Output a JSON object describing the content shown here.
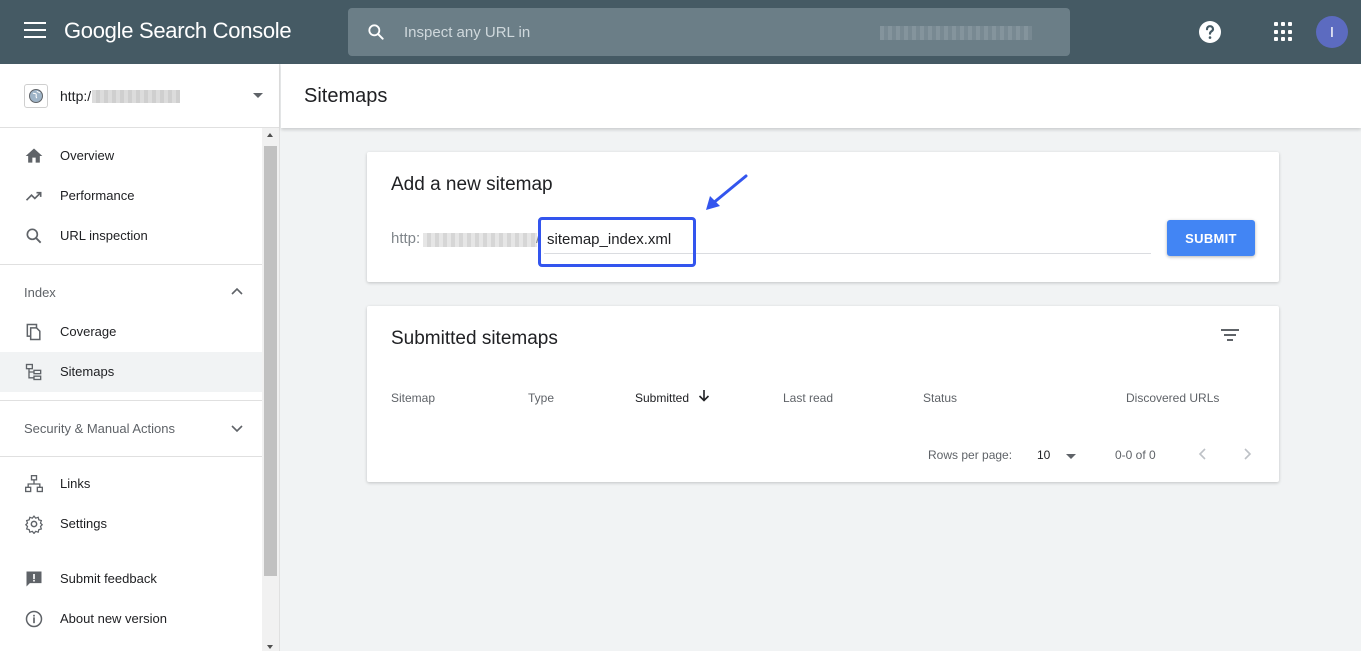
{
  "app": {
    "title": "Google Search Console"
  },
  "search": {
    "placeholder": "Inspect any URL in"
  },
  "user": {
    "avatar_initial": "I"
  },
  "property": {
    "url": "http:/"
  },
  "sidebar": {
    "items": [
      {
        "label": "Overview",
        "icon": "home-icon"
      },
      {
        "label": "Performance",
        "icon": "trending-up-icon"
      },
      {
        "label": "URL inspection",
        "icon": "search-icon"
      }
    ],
    "index_section": {
      "label": "Index",
      "items": [
        {
          "label": "Coverage",
          "icon": "copy-icon"
        },
        {
          "label": "Sitemaps",
          "icon": "sitemap-icon",
          "active": true
        }
      ]
    },
    "security_section": {
      "label": "Security & Manual Actions"
    },
    "bottom_items": [
      {
        "label": "Links",
        "icon": "links-icon"
      },
      {
        "label": "Settings",
        "icon": "gear-icon"
      }
    ],
    "footer_items": [
      {
        "label": "Submit feedback",
        "icon": "feedback-icon"
      },
      {
        "label": "About new version",
        "icon": "info-icon"
      }
    ]
  },
  "page": {
    "title": "Sitemaps"
  },
  "add_sitemap": {
    "title": "Add a new sitemap",
    "prefix": "http:",
    "slash": "/",
    "value": "sitemap_index.xml",
    "submit_label": "SUBMIT"
  },
  "submitted": {
    "title": "Submitted sitemaps",
    "columns": [
      "Sitemap",
      "Type",
      "Submitted",
      "Last read",
      "Status",
      "Discovered URLs"
    ],
    "sorted_column": "Submitted",
    "rows_per_page_label": "Rows per page:",
    "rows_per_page": "10",
    "range": "0-0 of 0"
  },
  "colors": {
    "topbar": "#455a64",
    "accent": "#4285f4",
    "highlight": "#3355ee",
    "avatar": "#5c6bc0"
  }
}
